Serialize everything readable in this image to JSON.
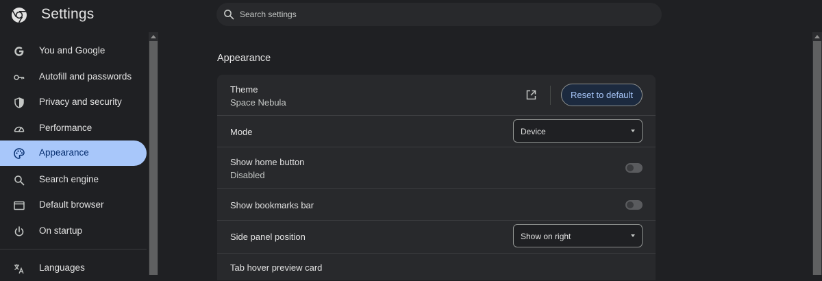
{
  "app": {
    "title": "Settings"
  },
  "search": {
    "placeholder": "Search settings"
  },
  "sidebar": {
    "items": [
      {
        "label": "You and Google",
        "icon": "google-g-icon"
      },
      {
        "label": "Autofill and passwords",
        "icon": "key-icon"
      },
      {
        "label": "Privacy and security",
        "icon": "shield-icon"
      },
      {
        "label": "Performance",
        "icon": "speedometer-icon"
      },
      {
        "label": "Appearance",
        "icon": "palette-icon",
        "active": true
      },
      {
        "label": "Search engine",
        "icon": "search-icon"
      },
      {
        "label": "Default browser",
        "icon": "browser-window-icon"
      },
      {
        "label": "On startup",
        "icon": "power-icon"
      },
      {
        "label": "Languages",
        "icon": "translate-icon"
      }
    ]
  },
  "main": {
    "section_title": "Appearance",
    "theme": {
      "label": "Theme",
      "value": "Space Nebula",
      "reset_label": "Reset to default"
    },
    "mode": {
      "label": "Mode",
      "selected": "Device"
    },
    "home_button": {
      "label": "Show home button",
      "value": "Disabled",
      "enabled": false
    },
    "bookmarks_bar": {
      "label": "Show bookmarks bar",
      "enabled": false
    },
    "side_panel": {
      "label": "Side panel position",
      "selected": "Show on right"
    },
    "tab_hover": {
      "label": "Tab hover preview card"
    }
  },
  "colors": {
    "background": "#1f2023",
    "card": "#28292c",
    "accent": "#a8c7fa",
    "active_text": "#062e6f"
  }
}
